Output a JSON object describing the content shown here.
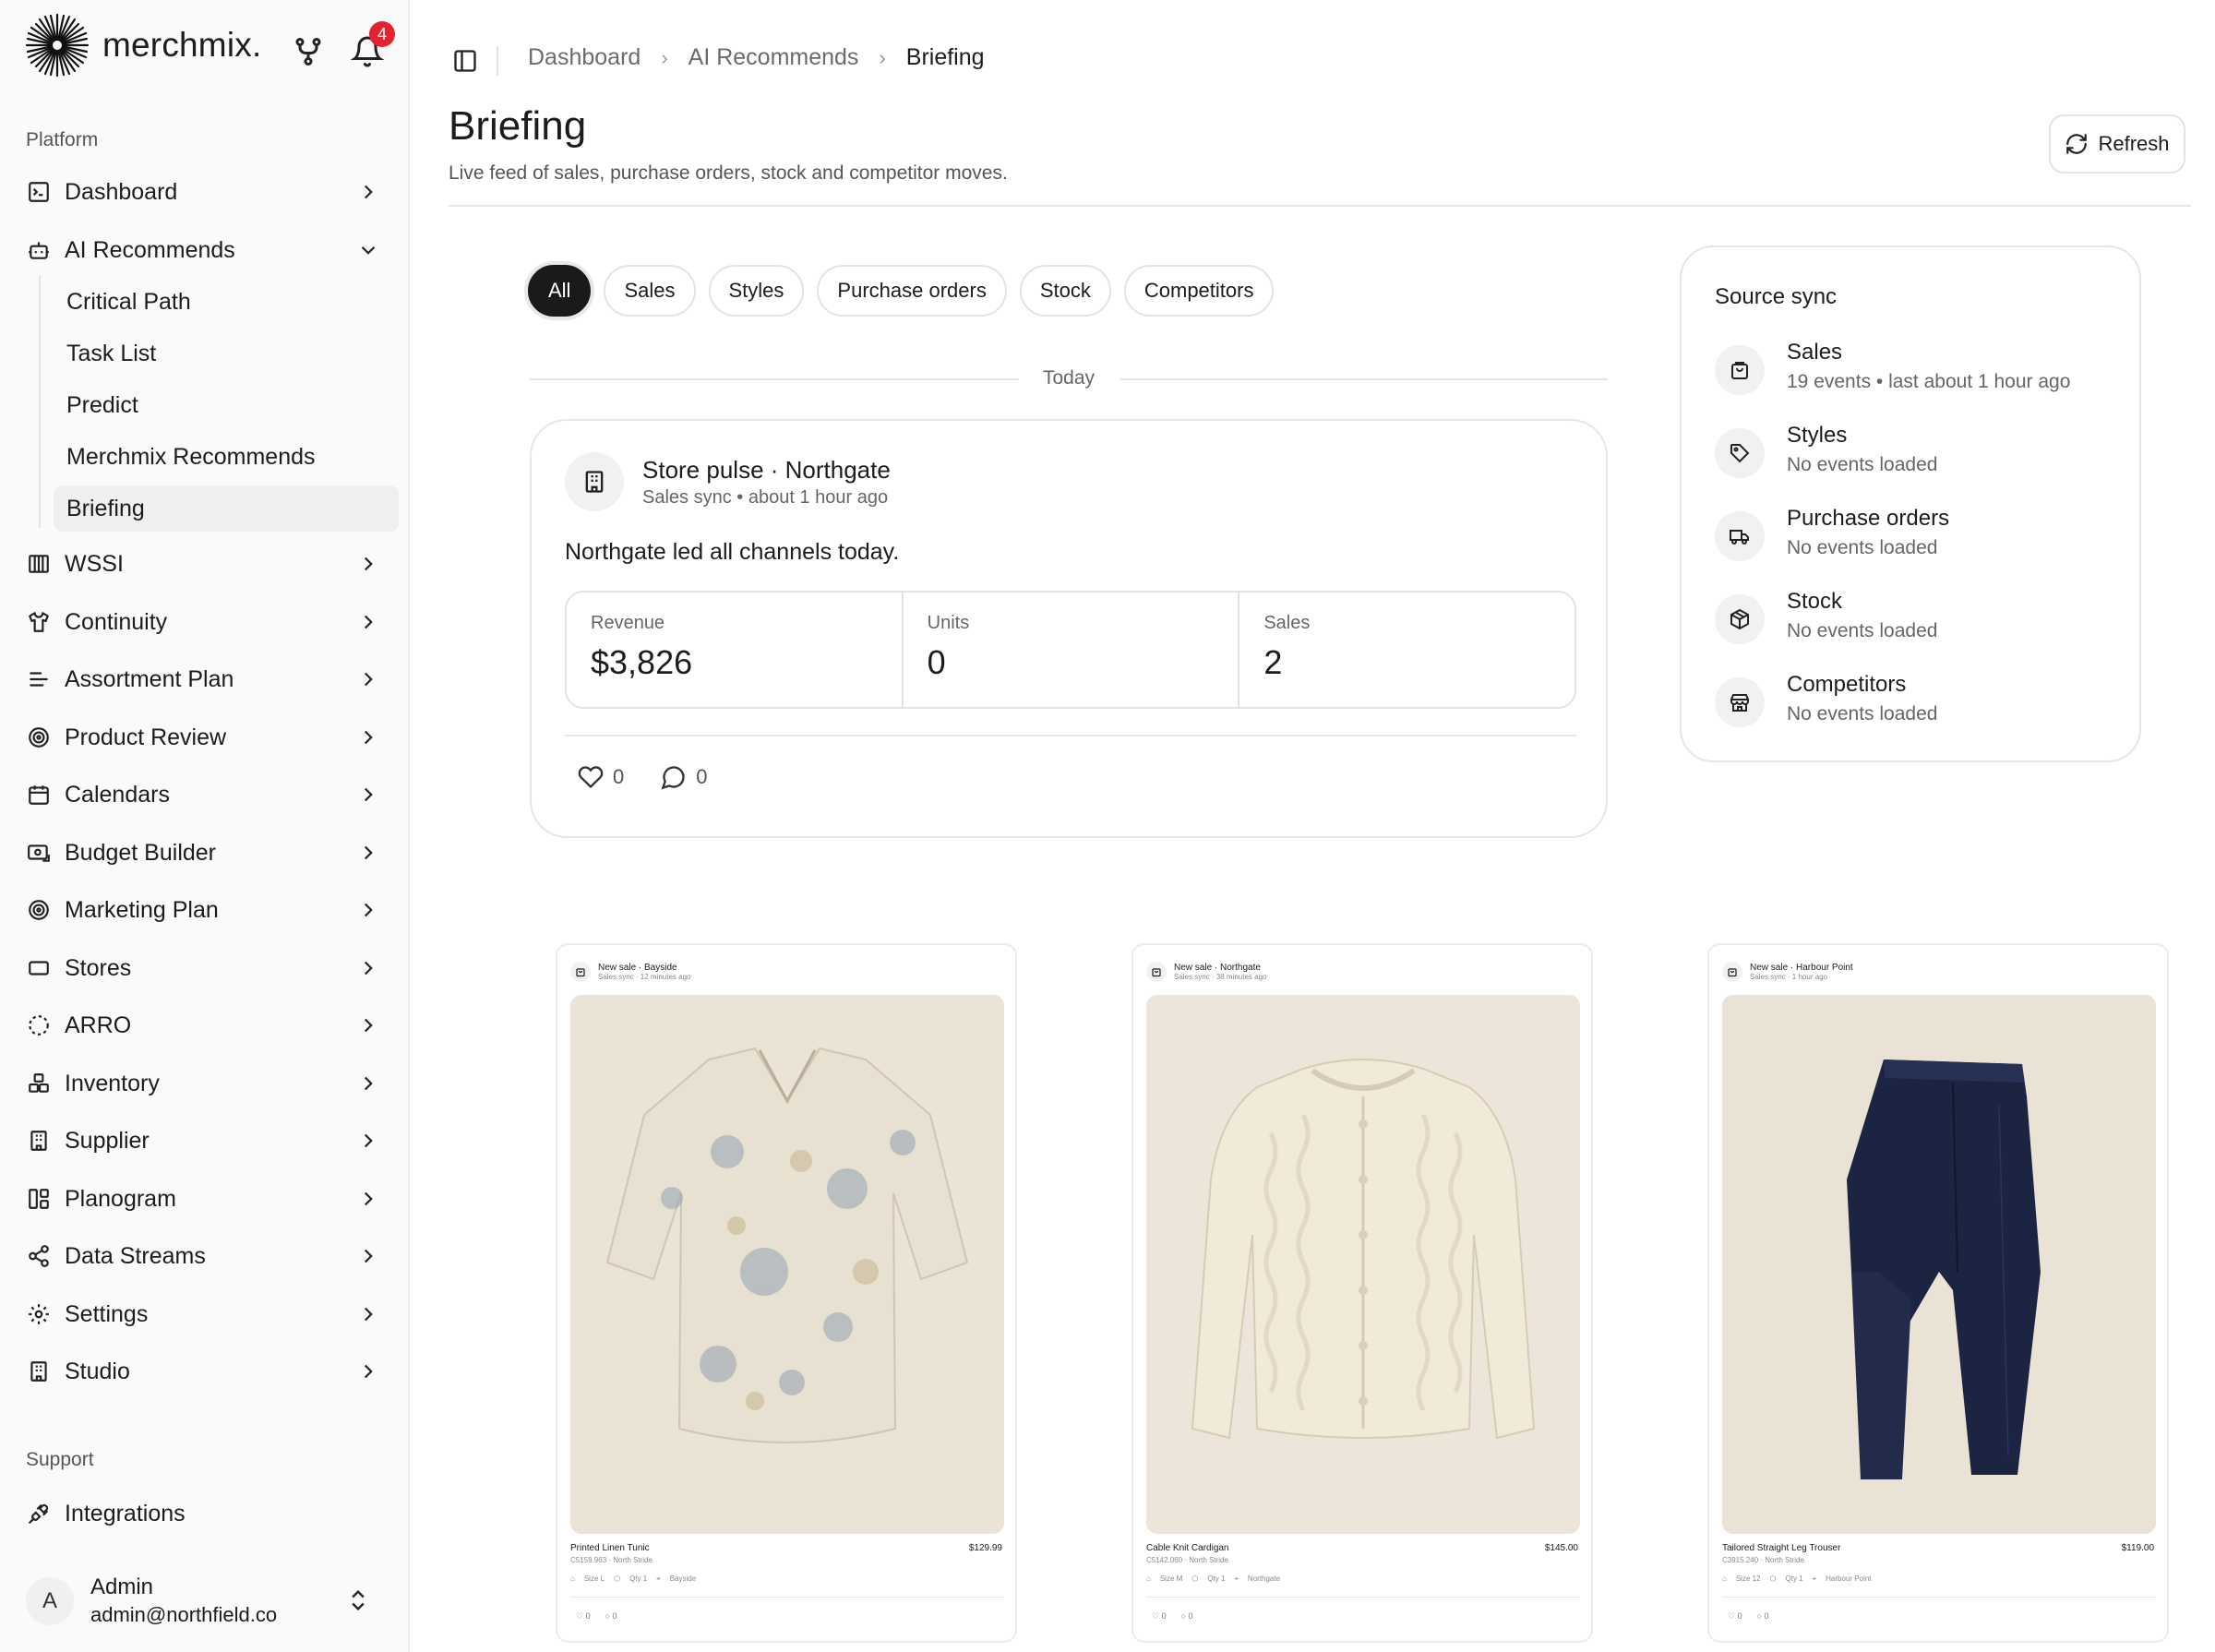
{
  "app": {
    "brand": "merchmix.",
    "notification_count": "4"
  },
  "sidebar": {
    "platform_label": "Platform",
    "support_label": "Support",
    "items": [
      {
        "label": "Dashboard",
        "icon": "terminal-icon"
      },
      {
        "label": "AI Recommends",
        "icon": "bot-icon"
      },
      {
        "label": "WSSI",
        "icon": "columns-icon"
      },
      {
        "label": "Continuity",
        "icon": "shirt-icon"
      },
      {
        "label": "Assortment Plan",
        "icon": "list-icon"
      },
      {
        "label": "Product Review",
        "icon": "target-icon"
      },
      {
        "label": "Calendars",
        "icon": "calendar-icon"
      },
      {
        "label": "Budget Builder",
        "icon": "budget-icon"
      },
      {
        "label": "Marketing Plan",
        "icon": "target-icon"
      },
      {
        "label": "Stores",
        "icon": "store-icon"
      },
      {
        "label": "ARRO",
        "icon": "dashed-circle-icon"
      },
      {
        "label": "Inventory",
        "icon": "boxes-icon"
      },
      {
        "label": "Supplier",
        "icon": "building-icon"
      },
      {
        "label": "Planogram",
        "icon": "layout-icon"
      },
      {
        "label": "Data Streams",
        "icon": "share-icon"
      },
      {
        "label": "Settings",
        "icon": "gear-icon"
      },
      {
        "label": "Studio",
        "icon": "building-icon"
      }
    ],
    "sub_items": [
      "Critical Path",
      "Task List",
      "Predict",
      "Merchmix Recommends",
      "Briefing"
    ],
    "support_items": [
      {
        "label": "Integrations",
        "icon": "plug-icon"
      }
    ],
    "user": {
      "initial": "A",
      "name": "Admin",
      "email": "admin@northfield.co"
    }
  },
  "header": {
    "breadcrumbs": [
      "Dashboard",
      "AI Recommends",
      "Briefing"
    ],
    "title": "Briefing",
    "subtitle": "Live feed of sales, purchase orders, stock and competitor moves.",
    "refresh_label": "Refresh"
  },
  "filters": [
    "All",
    "Sales",
    "Styles",
    "Purchase orders",
    "Stock",
    "Competitors"
  ],
  "active_filter": "All",
  "day_label": "Today",
  "pulse_card": {
    "title": "Store pulse · Northgate",
    "meta": "Sales sync • about 1 hour ago",
    "body": "Northgate led all channels today.",
    "stats": [
      {
        "label": "Revenue",
        "value": "$3,826"
      },
      {
        "label": "Units",
        "value": "0"
      },
      {
        "label": "Sales",
        "value": "2"
      }
    ],
    "likes": "0",
    "comments": "0"
  },
  "source_sync": {
    "title": "Source sync",
    "rows": [
      {
        "name": "Sales",
        "status": "19 events • last about 1 hour ago",
        "icon": "bag-icon"
      },
      {
        "name": "Styles",
        "status": "No events loaded",
        "icon": "tag-icon"
      },
      {
        "name": "Purchase orders",
        "status": "No events loaded",
        "icon": "truck-icon"
      },
      {
        "name": "Stock",
        "status": "No events loaded",
        "icon": "package-icon"
      },
      {
        "name": "Competitors",
        "status": "No events loaded",
        "icon": "store-icon"
      }
    ]
  },
  "products": [
    {
      "title": "New sale · Bayside",
      "meta": "Sales sync · 12 minutes ago",
      "name": "Printed Linen Tunic",
      "price": "$129.99",
      "code": "C5159.963 · North Stride",
      "size": "Size L",
      "qty": "Qty 1",
      "store": "Bayside",
      "likes": "0",
      "comments": "0"
    },
    {
      "title": "New sale · Northgate",
      "meta": "Sales sync · 38 minutes ago",
      "name": "Cable Knit Cardigan",
      "price": "$145.00",
      "code": "C5142.060 · North Stride",
      "size": "Size M",
      "qty": "Qty 1",
      "store": "Northgate",
      "likes": "0",
      "comments": "0"
    },
    {
      "title": "New sale · Harbour Point",
      "meta": "Sales sync · 1 hour ago",
      "name": "Tailored Straight Leg Trouser",
      "price": "$119.00",
      "code": "C3915.240 · North Stride",
      "size": "Size 12",
      "qty": "Qty 1",
      "store": "Harbour Point",
      "likes": "0",
      "comments": "0"
    }
  ],
  "colors": {
    "accent": "#1a1a1a",
    "badge": "#e5222f",
    "border": "#e6e6e6"
  }
}
